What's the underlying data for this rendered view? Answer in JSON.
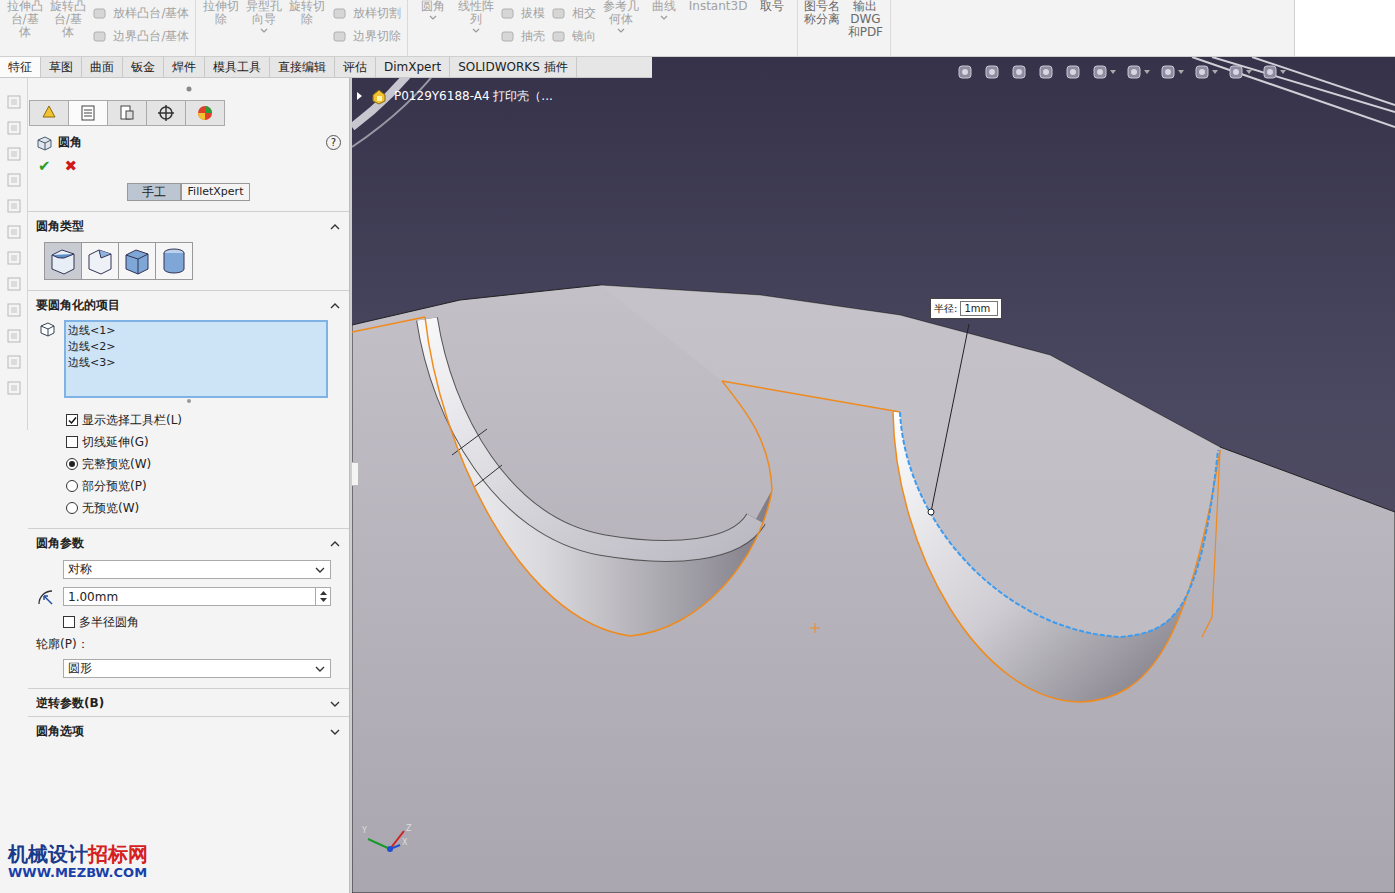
{
  "ribbon": [
    {
      "items": [
        {
          "label": "拉伸凸台/基体",
          "kind": "large",
          "disabled": true,
          "menu": false
        },
        {
          "label": "旋转凸台/基体",
          "kind": "large",
          "disabled": true,
          "menu": false
        },
        {
          "label": "放样凸台/基体",
          "kind": "small",
          "disabled": true,
          "menu": false
        },
        {
          "label": "边界凸台/基体",
          "kind": "small",
          "disabled": true,
          "menu": false
        }
      ]
    },
    {
      "items": [
        {
          "label": "拉伸切除",
          "kind": "large",
          "disabled": true,
          "menu": false
        },
        {
          "label": "异型孔向导",
          "kind": "large",
          "disabled": true,
          "menu": true
        },
        {
          "label": "旋转切除",
          "kind": "large",
          "disabled": true,
          "menu": false
        },
        {
          "label": "放样切割",
          "kind": "small",
          "disabled": true,
          "menu": false
        },
        {
          "label": "边界切除",
          "kind": "small",
          "disabled": true,
          "menu": false
        }
      ]
    },
    {
      "items": [
        {
          "label": "圆角",
          "kind": "large",
          "disabled": true,
          "menu": true
        },
        {
          "label": "线性阵列",
          "kind": "large",
          "disabled": true,
          "menu": true
        },
        {
          "label": "拔模",
          "kind": "small",
          "disabled": true,
          "menu": false
        },
        {
          "label": "抽壳",
          "kind": "small",
          "disabled": true,
          "menu": false
        },
        {
          "label": "相交",
          "kind": "small",
          "disabled": true,
          "menu": false
        },
        {
          "label": "镜向",
          "kind": "small",
          "disabled": true,
          "menu": false
        },
        {
          "label": "参考几何体",
          "kind": "large",
          "disabled": true,
          "menu": true
        },
        {
          "label": "曲线",
          "kind": "large",
          "disabled": true,
          "menu": true
        },
        {
          "label": "Instant3D",
          "kind": "large",
          "disabled": true,
          "menu": false
        },
        {
          "label": "取号",
          "kind": "large",
          "disabled": false,
          "menu": false
        }
      ]
    },
    {
      "items": [
        {
          "label": "图号名称分离",
          "kind": "large",
          "disabled": false,
          "menu": false
        },
        {
          "label": "输出DWG和PDF",
          "kind": "large",
          "disabled": false,
          "menu": false
        }
      ]
    }
  ],
  "tabs": [
    {
      "label": "特征",
      "selected": true
    },
    {
      "label": "草图",
      "selected": false
    },
    {
      "label": "曲面",
      "selected": false
    },
    {
      "label": "钣金",
      "selected": false
    },
    {
      "label": "焊件",
      "selected": false
    },
    {
      "label": "模具工具",
      "selected": false
    },
    {
      "label": "直接编辑",
      "selected": false
    },
    {
      "label": "评估",
      "selected": false
    },
    {
      "label": "DimXpert",
      "selected": false
    },
    {
      "label": "SOLIDWORKS 插件",
      "selected": false
    }
  ],
  "panel_tabs": [
    {
      "selected": false
    },
    {
      "selected": true
    },
    {
      "selected": false
    },
    {
      "selected": false
    },
    {
      "selected": false
    }
  ],
  "feature": {
    "title": "圆角",
    "help": "?",
    "ok": "✔",
    "cancel": "✖"
  },
  "mode_buttons": [
    {
      "label": "手工",
      "selected": true
    },
    {
      "label": "FilletXpert",
      "selected": false
    }
  ],
  "fillet_type": {
    "title": "圆角类型",
    "expanded": true,
    "options": [
      {
        "selected": true
      },
      {
        "selected": false
      },
      {
        "selected": false
      },
      {
        "selected": false
      }
    ]
  },
  "items_section": {
    "title": "要圆角化的项目",
    "expanded": true,
    "edges": [
      "边线<1>",
      "边线<2>",
      "边线<3>"
    ]
  },
  "options": [
    {
      "kind": "checkbox",
      "label": "显示选择工具栏(L)",
      "checked": true
    },
    {
      "kind": "checkbox",
      "label": "切线延伸(G)",
      "checked": false
    },
    {
      "kind": "radio",
      "label": "完整预览(W)",
      "selected": true
    },
    {
      "kind": "radio",
      "label": "部分预览(P)",
      "selected": false
    },
    {
      "kind": "radio",
      "label": "无预览(W)",
      "selected": false
    }
  ],
  "params": {
    "title": "圆角参数",
    "expanded": true,
    "mode": "对称",
    "radius": "1.00mm",
    "multi_radius": {
      "label": "多半径圆角",
      "checked": false
    },
    "profile_label": "轮廓(P)：",
    "profile": "圆形"
  },
  "collapsed_sections": [
    {
      "title": "逆转参数(B)",
      "expanded": false
    },
    {
      "title": "圆角选项",
      "expanded": false
    }
  ],
  "viewport": {
    "breadcrumb": "P0129Y6188-A4 打印壳（...",
    "callout": {
      "label": "半径:",
      "value": "1mm"
    },
    "triad": [
      "Y",
      "Z",
      "X"
    ]
  },
  "watermark": {
    "parts": [
      {
        "text": "机械设计",
        "color": "#1a3a8a"
      },
      {
        "text": "招标网",
        "color": "#d42020"
      }
    ],
    "url": "WWW.MEZBW.COM"
  }
}
